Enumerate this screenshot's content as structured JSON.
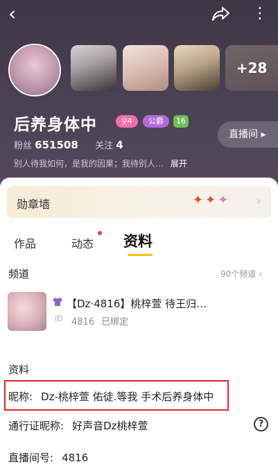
{
  "header": {
    "back_icon": "chevron-left-icon",
    "share_icon": "share-icon",
    "more_icon": "more-vertical-icon",
    "more_photos_count": "+28",
    "name": "后养身体中",
    "badges": {
      "gender_level": "♀4",
      "club": "公爵",
      "level": "16"
    },
    "stats": {
      "fans_label": "粉丝",
      "fans_value": "651508",
      "follow_label": "关注",
      "follow_value": "4"
    },
    "bio": "别人待我如何，是我的因果；我待别人…",
    "expand_label": "展开",
    "live_button_label": "直播间 ▸"
  },
  "medal_wall": {
    "label": "勋章墙",
    "arrow": "›"
  },
  "tabs": {
    "works": "作品",
    "moments": "动态",
    "profile": "资料"
  },
  "channel": {
    "heading": "频道",
    "count_label": "90个频道",
    "count_arrow": "›",
    "card_title": "【Dz·4816】桃梓萱 待王归…",
    "id_tag": "ID",
    "card_id": "4816",
    "card_status": "已绑定"
  },
  "profile_info": {
    "heading": "资料",
    "nickname_label": "昵称:",
    "nickname_value": "Dz-桃梓萱 佑徒.等我 手术后养身体中",
    "pass_nickname_label": "通行证昵称:",
    "pass_nickname_value": "好声音Dz桃梓萱",
    "room_label": "直播间号:",
    "room_value": "4816",
    "help_symbol": "?"
  },
  "colors": {
    "header_bg": "#4a4154",
    "highlight_box": "#e8202a",
    "tab_underline": "#f5c400",
    "notification_dot": "#e8423a"
  }
}
